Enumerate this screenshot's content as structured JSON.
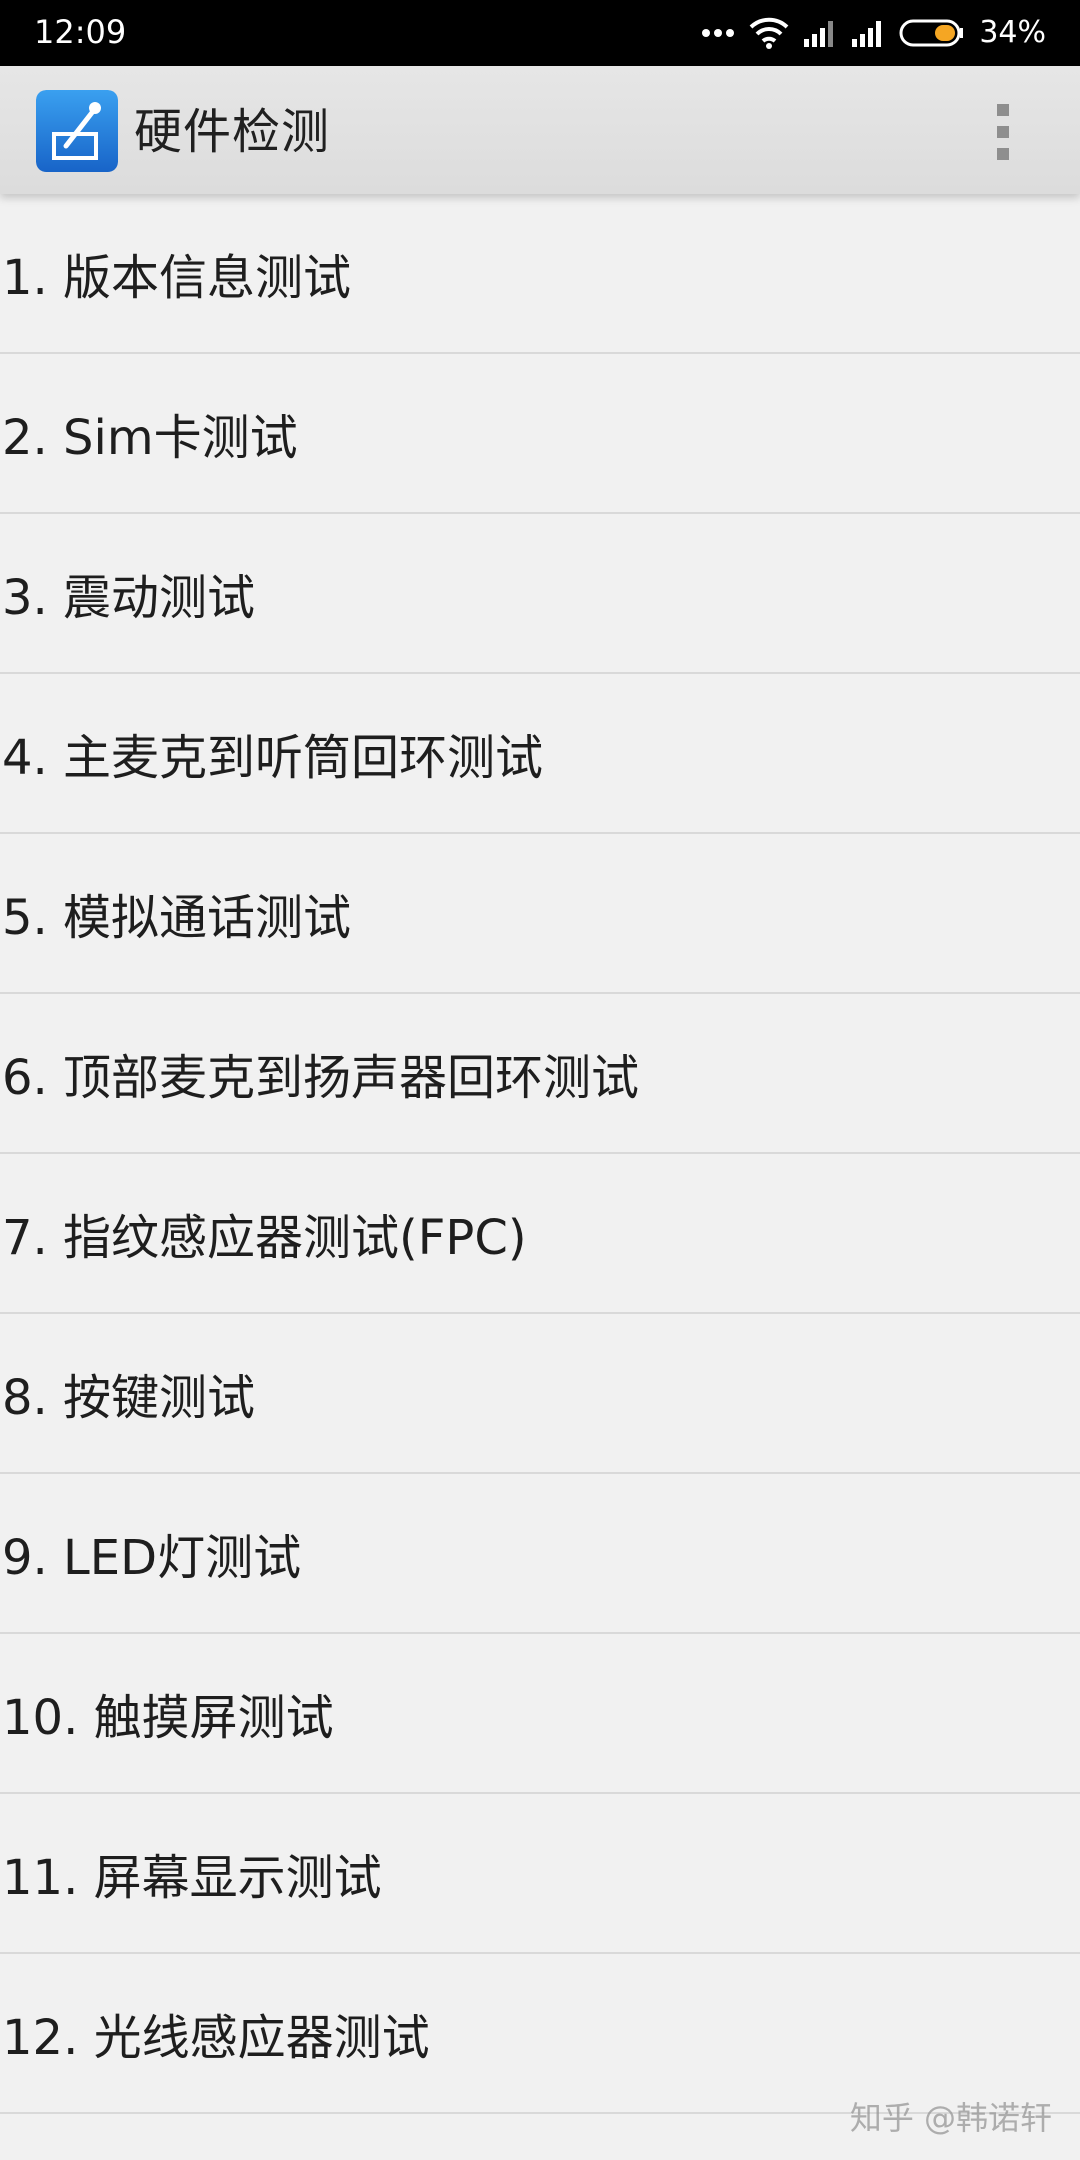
{
  "status_bar": {
    "time": "12:09",
    "battery": "34%"
  },
  "app_bar": {
    "title": "硬件检测"
  },
  "tests": [
    "1. 版本信息测试",
    "2. Sim卡测试",
    "3. 震动测试",
    "4. 主麦克到听筒回环测试",
    "5. 模拟通话测试",
    "6. 顶部麦克到扬声器回环测试",
    "7. 指纹感应器测试(FPC)",
    "8. 按键测试",
    "9. LED灯测试",
    "10. 触摸屏测试",
    "11. 屏幕显示测试",
    "12. 光线感应器测试"
  ],
  "watermark": "知乎 @韩诺轩"
}
